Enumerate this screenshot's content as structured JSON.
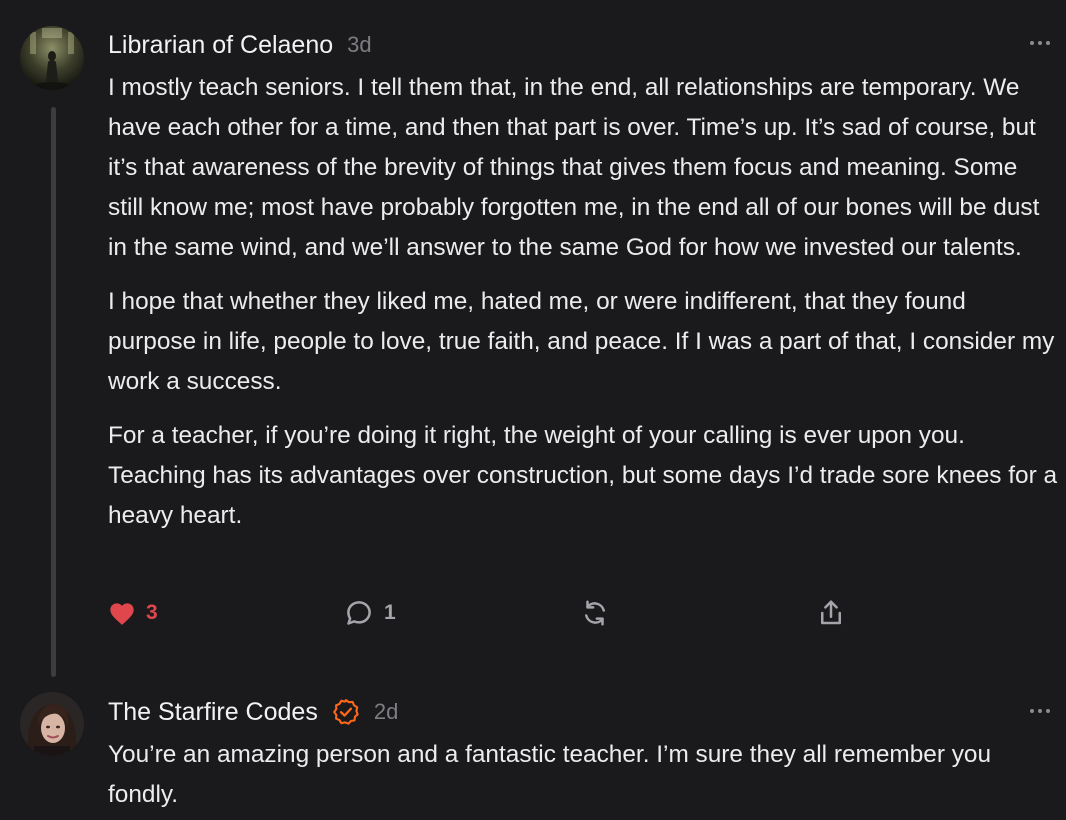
{
  "comments": [
    {
      "author": "Librarian of Celaeno",
      "time": "3d",
      "paragraphs": [
        "I mostly teach seniors. I tell them that, in the end, all relationships are temporary. We have each other for a time, and then that part is over. Time’s up. It’s sad of course, but it’s that awareness of the brevity of things that gives them focus and meaning. Some still know me; most have probably forgotten me, in the end all of our bones will be dust in the same wind, and we’ll answer to the same God for how we invested our talents.",
        "I hope that whether they liked me, hated me, or were indifferent, that they found purpose in life, people to love, true faith, and peace. If I was a part of that, I consider my work a success.",
        "For a teacher, if you’re doing it right, the weight of your calling is ever upon you. Teaching has its advantages over construction, but some days I’d trade sore knees for a heavy heart."
      ],
      "likes": "3",
      "replies": "1",
      "liked": true,
      "icons": [
        "heart-icon",
        "comment-icon",
        "restack-icon",
        "share-icon",
        "more-icon"
      ]
    },
    {
      "author": "The Starfire Codes",
      "time": "2d",
      "verified": true,
      "paragraphs": [
        "You’re an amazing person and a fantastic teacher. I’m sure they all remember you fondly."
      ]
    }
  ],
  "colors": {
    "background": "#1a1a1c",
    "like": "#e0474c",
    "verified": "#ff6719",
    "muted": "#7d7d82"
  }
}
